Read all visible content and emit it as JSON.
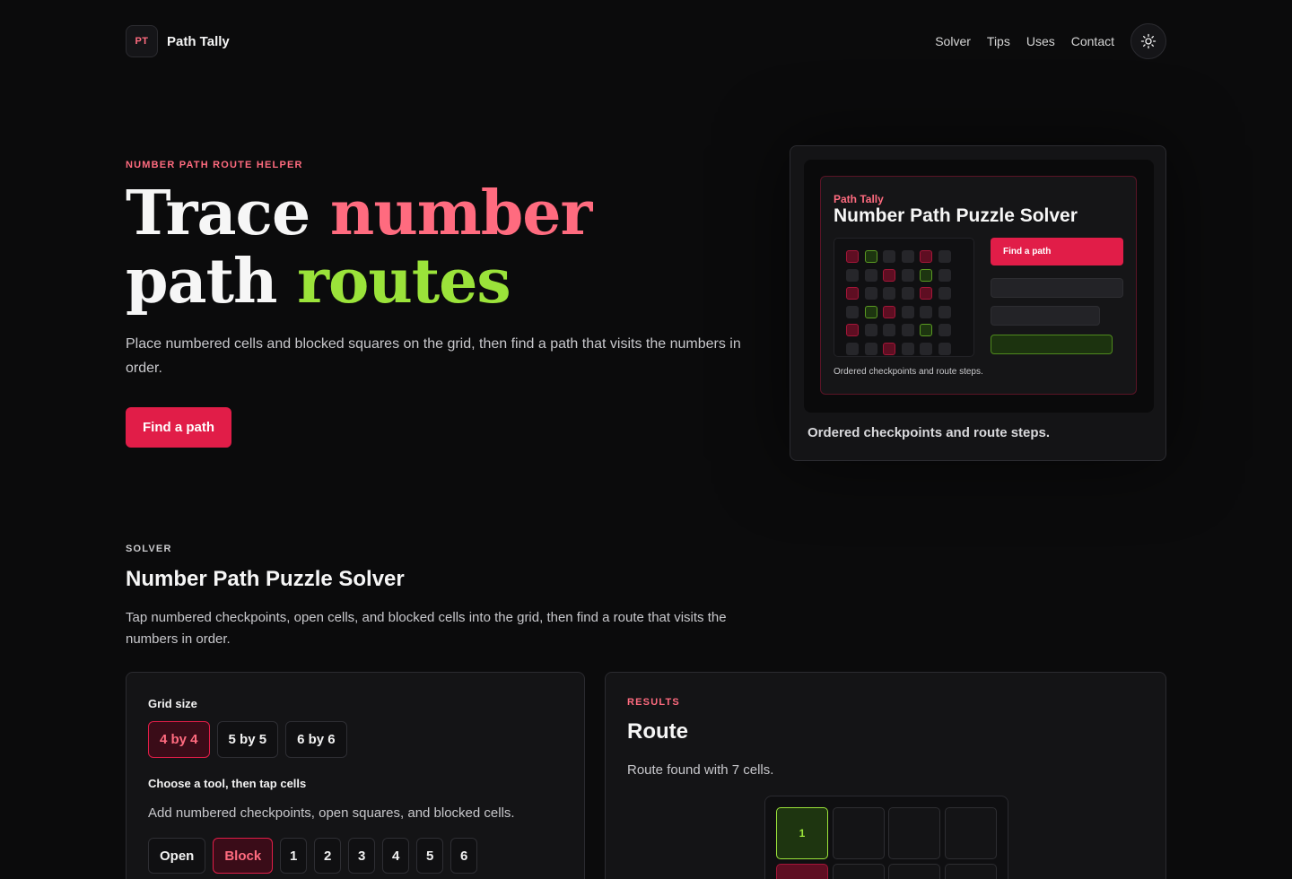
{
  "header": {
    "logo_text": "PT",
    "brand": "Path Tally",
    "nav": [
      "Solver",
      "Tips",
      "Uses",
      "Contact"
    ],
    "theme_icon": "sun-icon"
  },
  "hero": {
    "eyebrow": "NUMBER PATH ROUTE HELPER",
    "title_1": "Trace ",
    "title_2": "number",
    "title_3": "path ",
    "title_4": "routes",
    "description": "Place numbered cells and blocked squares on the grid, then find a path that visits the numbers in order.",
    "cta": "Find a path"
  },
  "preview": {
    "brand": "Path Tally",
    "title": "Number Path Puzzle Solver",
    "button": "Find a path",
    "inner_caption": "Ordered checkpoints and route steps.",
    "caption": "Ordered checkpoints and route steps.",
    "grid": [
      [
        "r",
        "g",
        "",
        "",
        "r",
        ""
      ],
      [
        "",
        "",
        "r",
        "",
        "g",
        ""
      ],
      [
        "r",
        "",
        "",
        "",
        "r",
        ""
      ],
      [
        "",
        "g",
        "r",
        "",
        "",
        ""
      ],
      [
        "r",
        "",
        "",
        "",
        "g",
        ""
      ],
      [
        "",
        "",
        "r",
        "",
        "",
        ""
      ]
    ]
  },
  "solver": {
    "eyebrow": "SOLVER",
    "title": "Number Path Puzzle Solver",
    "description": "Tap numbered checkpoints, open cells, and blocked cells into the grid, then find a route that visits the numbers in order.",
    "grid_size_label": "Grid size",
    "sizes": [
      "4 by 4",
      "5 by 5",
      "6 by 6"
    ],
    "tool_label": "Choose a tool, then tap cells",
    "tool_description": "Add numbered checkpoints, open squares, and blocked cells.",
    "tools": [
      "Open",
      "Block",
      "1",
      "2",
      "3",
      "4",
      "5",
      "6"
    ]
  },
  "results": {
    "eyebrow": "RESULTS",
    "title": "Route",
    "status": "Route found with 7 cells.",
    "board": [
      [
        "1",
        "",
        "",
        ""
      ],
      [
        "#",
        "",
        "",
        ""
      ]
    ]
  },
  "colors": {
    "accent": "#e11d48",
    "accent_text": "#ff6b7f",
    "green": "#9be33a",
    "background": "#0b0b0c"
  }
}
